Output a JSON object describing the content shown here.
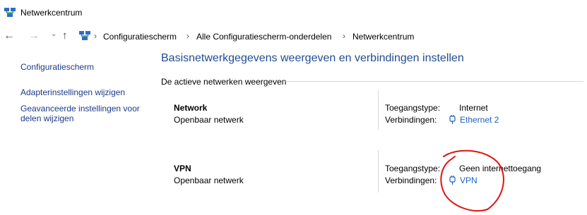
{
  "window": {
    "title": "Netwerkcentrum"
  },
  "address": {
    "crumbs": [
      "Configuratiescherm",
      "Alle Configuratiescherm-onderdelen",
      "Netwerkcentrum"
    ]
  },
  "sidebar": {
    "items": [
      {
        "label": "Configuratiescherm"
      },
      {
        "label": "Adapterinstellingen wijzigen"
      },
      {
        "label": "Geavanceerde instellingen voor delen wijzigen"
      }
    ]
  },
  "main": {
    "title": "Basisnetwerkgegevens weergeven en verbindingen instellen",
    "section": "De actieve netwerken weergeven",
    "networks": [
      {
        "name": "Network",
        "type": "Openbaar netwerk",
        "access_label": "Toegangstype:",
        "access": "Internet",
        "connections_label": "Verbindingen:",
        "connection": "Ethernet 2"
      },
      {
        "name": "VPN",
        "type": "Openbaar netwerk",
        "access_label": "Toegangstype:",
        "access": "Geen internettoegang",
        "connections_label": "Verbindingen:",
        "connection": "VPN"
      }
    ]
  },
  "colors": {
    "link": "#1b62c4",
    "title": "#1f4d93",
    "annotation": "#e21212"
  },
  "icons": {
    "app": "network-center-icon",
    "plug": "plug-icon"
  }
}
